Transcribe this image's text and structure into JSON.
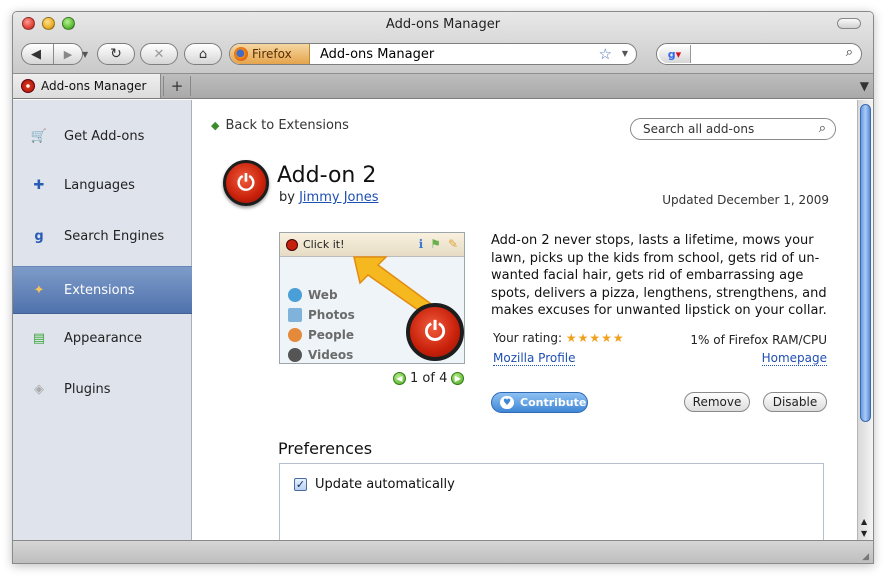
{
  "window": {
    "title": "Add-ons Manager"
  },
  "toolbar": {
    "identity_label": "Firefox",
    "url_value": "Add-ons Manager",
    "search_value": ""
  },
  "tabs": [
    {
      "label": "Add-ons Manager"
    }
  ],
  "sidebar": {
    "items": [
      {
        "label": "Get Add-ons",
        "icon": "cart-icon",
        "selected": false
      },
      {
        "label": "Languages",
        "icon": "flag-icon",
        "selected": false
      },
      {
        "label": "Search Engines",
        "icon": "google-icon",
        "selected": false
      },
      {
        "label": "Extensions",
        "icon": "puzzle-icon",
        "selected": true
      },
      {
        "label": "Appearance",
        "icon": "palette-icon",
        "selected": false
      },
      {
        "label": "Plugins",
        "icon": "plugin-icon",
        "selected": false
      }
    ]
  },
  "main": {
    "back_label": "Back to Extensions",
    "search_placeholder": "Search all add-ons",
    "addon": {
      "name": "Add-on 2",
      "by_prefix": "by",
      "author": "Jimmy Jones",
      "updated": "Updated December 1, 2009",
      "description": "Add-on 2 never stops, lasts a lifetime, mows your lawn, picks up the kids from school, gets rid of un- wanted facial hair, gets rid of embarrassing age spots, delivers a pizza, lengthens, strengthens, and makes excuses for unwanted lipstick on your collar.",
      "rating_label": "Your rating:",
      "rating_stars": 5,
      "resource_usage": "1% of Firefox RAM/CPU",
      "profile_link": "Mozilla Profile",
      "homepage_link": "Homepage",
      "contribute_label": "Contribute",
      "remove_label": "Remove",
      "disable_label": "Disable"
    },
    "screenshot": {
      "button_label": "Click it!",
      "list": [
        "Web",
        "Photos",
        "People",
        "Videos"
      ],
      "pager": "1 of 4"
    },
    "preferences": {
      "title": "Preferences",
      "update_label": "Update automatically",
      "update_checked": true
    }
  },
  "colors": {
    "sidebar_bg": "#dfe4ec",
    "selected_bg": "#4f72ad",
    "link": "#1e4fb3",
    "contribute": "#3f86d6",
    "stars": "#f0a21e"
  }
}
